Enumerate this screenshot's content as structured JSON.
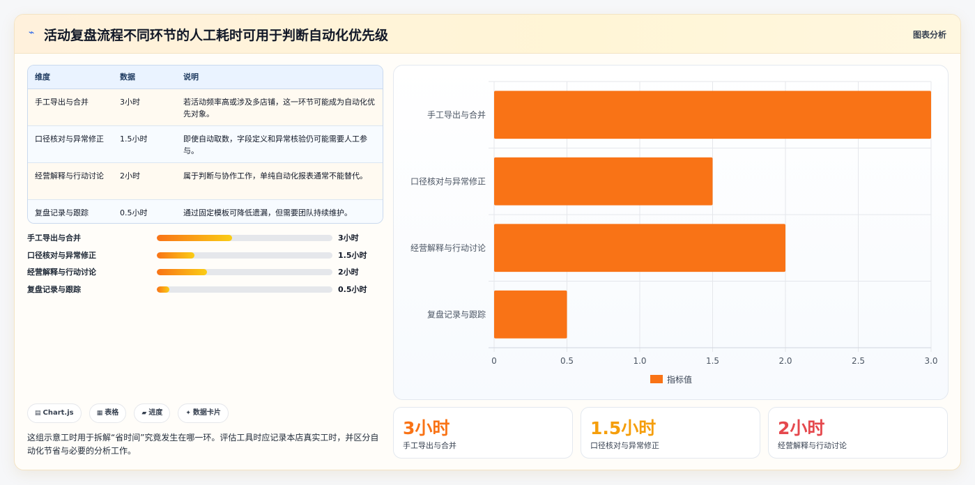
{
  "header": {
    "icon": "chart-line-icon",
    "title": "活动复盘流程不同环节的人工耗时可用于判断自动化优先级",
    "tag": "图表分析"
  },
  "table": {
    "headers": [
      "维度",
      "数据",
      "说明"
    ],
    "rows": [
      {
        "dim": "手工导出与合并",
        "value": "3小时",
        "desc": "若活动频率高或涉及多店铺，这一环节可能成为自动化优先对象。"
      },
      {
        "dim": "口径核对与异常修正",
        "value": "1.5小时",
        "desc": "即使自动取数，字段定义和异常核验仍可能需要人工参与。"
      },
      {
        "dim": "经营解释与行动讨论",
        "value": "2小时",
        "desc": "属于判断与协作工作，单纯自动化报表通常不能替代。"
      },
      {
        "dim": "复盘记录与跟踪",
        "value": "0.5小时",
        "desc": "通过固定模板可降低遗漏，但需要团队持续维护。"
      }
    ]
  },
  "progress": {
    "max": 7,
    "items": [
      {
        "label": "手工导出与合并",
        "value": 3,
        "value_text": "3小时"
      },
      {
        "label": "口径核对与异常修正",
        "value": 1.5,
        "value_text": "1.5小时"
      },
      {
        "label": "经营解释与行动讨论",
        "value": 2,
        "value_text": "2小时"
      },
      {
        "label": "复盘记录与跟踪",
        "value": 0.5,
        "value_text": "0.5小时"
      }
    ]
  },
  "chips": [
    {
      "icon": "bar-chart-icon",
      "glyph": "▤",
      "label": "Chart.js"
    },
    {
      "icon": "table-icon",
      "glyph": "▦",
      "label": "表格"
    },
    {
      "icon": "progress-icon",
      "glyph": "▰",
      "label": "进度"
    },
    {
      "icon": "sparkle-icon",
      "glyph": "✦",
      "label": "数据卡片"
    }
  ],
  "note": "这组示意工时用于拆解“省时间”究竟发生在哪一环。评估工具时应记录本店真实工时，并区分自动化节省与必要的分析工作。",
  "chart_data": {
    "type": "bar",
    "orientation": "horizontal",
    "categories": [
      "手工导出与合并",
      "口径核对与异常修正",
      "经营解释与行动讨论",
      "复盘记录与跟踪"
    ],
    "series": [
      {
        "name": "指标值",
        "values": [
          3,
          1.5,
          2,
          0.5
        ],
        "color": "#f97316"
      }
    ],
    "xlim": [
      0,
      3
    ],
    "xticks": [
      "0",
      "0.5",
      "1.0",
      "1.5",
      "2.0",
      "2.5",
      "3.0"
    ],
    "grid": true,
    "legend": "bottom"
  },
  "stats": [
    {
      "value": "3小时",
      "label": "手工导出与合并",
      "color": "#f97316"
    },
    {
      "value": "1.5小时",
      "label": "口径核对与异常修正",
      "color": "#f59e0b"
    },
    {
      "value": "2小时",
      "label": "经营解释与行动讨论",
      "color": "#e5484d"
    }
  ]
}
